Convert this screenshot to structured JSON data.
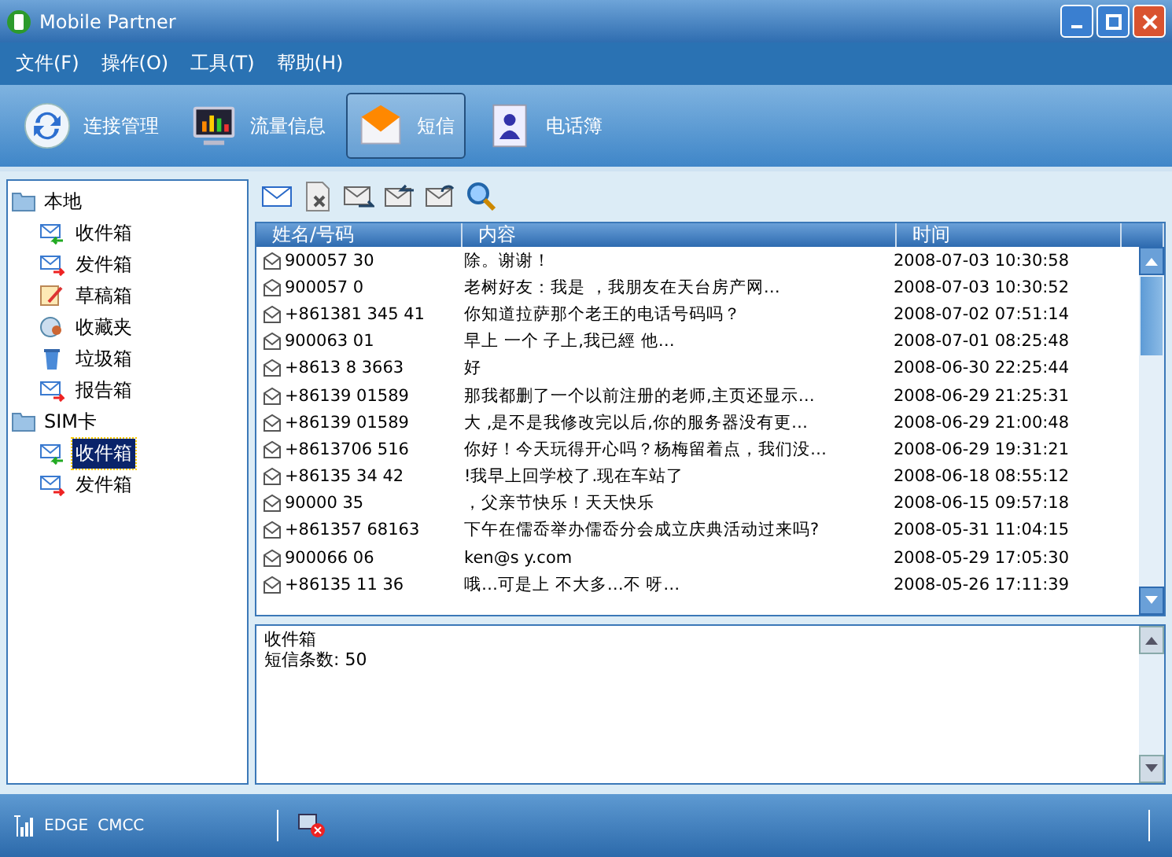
{
  "window": {
    "title": "Mobile Partner"
  },
  "menu": [
    "文件(F)",
    "操作(O)",
    "工具(T)",
    "帮助(H)"
  ],
  "nav": [
    {
      "label": "连接管理",
      "selected": false
    },
    {
      "label": "流量信息",
      "selected": false
    },
    {
      "label": "短信",
      "selected": true
    },
    {
      "label": "电话簿",
      "selected": false
    }
  ],
  "tree": [
    {
      "label": "本地",
      "selected": false,
      "children": [
        {
          "label": "收件箱",
          "selected": false
        },
        {
          "label": "发件箱",
          "selected": false
        },
        {
          "label": "草稿箱",
          "selected": false
        },
        {
          "label": "收藏夹",
          "selected": false
        },
        {
          "label": "垃圾箱",
          "selected": false
        },
        {
          "label": "报告箱",
          "selected": false
        }
      ]
    },
    {
      "label": "SIM卡",
      "selected": false,
      "children": [
        {
          "label": "收件箱",
          "selected": true
        },
        {
          "label": "发件箱",
          "selected": false
        }
      ]
    }
  ],
  "table": {
    "columns": [
      "姓名/号码",
      "内容",
      "时间"
    ],
    "rows": [
      {
        "name": "900057   30",
        "content": "除。谢谢！",
        "time": "2008-07-03 10:30:58"
      },
      {
        "name": "900057    0",
        "content": "老树好友：我是   ，我朋友在天台房产网…",
        "time": "2008-07-03 10:30:52"
      },
      {
        "name": "+861381 345  41",
        "content": "你知道拉萨那个老王的电话号码吗？",
        "time": "2008-07-02 07:51:14"
      },
      {
        "name": "900063   01",
        "content": "早上 一个    子上,我已經  他…",
        "time": "2008-07-01 08:25:48"
      },
      {
        "name": "+8613  8  3663",
        "content": "好",
        "time": "2008-06-30 22:25:44"
      },
      {
        "name": "+86139   01589",
        "content": "那我都删了一个以前注册的老师,主页还显示…",
        "time": "2008-06-29 21:25:31"
      },
      {
        "name": "+86139   01589",
        "content": "大  ,是不是我修改完以后,你的服务器没有更…",
        "time": "2008-06-29 21:00:48"
      },
      {
        "name": "+8613706    516",
        "content": "你好！今天玩得开心吗？杨梅留着点，我们没…",
        "time": "2008-06-29 19:31:21"
      },
      {
        "name": "+86135 34   42",
        "content": "!我早上回学校了.现在车站了",
        "time": "2008-06-18 08:55:12"
      },
      {
        "name": "90000   35",
        "content": "，父亲节快乐！天天快乐",
        "time": "2008-06-15 09:57:18"
      },
      {
        "name": "+861357 68163",
        "content": "下午在儒岙举办儒岙分会成立庆典活动过来吗?",
        "time": "2008-05-31 11:04:15"
      },
      {
        "name": "900066  06",
        "content": "ken@s   y.com",
        "time": "2008-05-29 17:05:30"
      },
      {
        "name": "+86135  11  36",
        "content": "哦…可是上 不大多…不   呀…",
        "time": "2008-05-26 17:11:39"
      }
    ]
  },
  "preview": {
    "title": "收件箱",
    "text": "短信条数: 50"
  },
  "status": {
    "network": "EDGE",
    "operator": "CMCC"
  }
}
